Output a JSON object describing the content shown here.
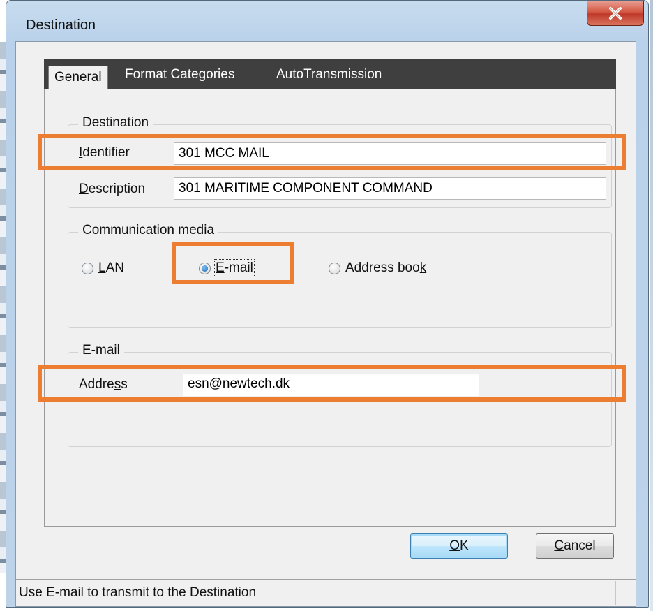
{
  "window": {
    "title": "Destination",
    "close_icon": "close-icon"
  },
  "tabs": [
    {
      "label": "General",
      "active": true
    },
    {
      "label": "Format Categories",
      "active": false
    },
    {
      "label": "AutoTransmission",
      "active": false
    }
  ],
  "destination_group": {
    "legend": "Destination",
    "identifier_label_ul": "I",
    "identifier_label_rest": "dentifier",
    "identifier_value": "301 MCC MAIL",
    "description_label_ul": "D",
    "description_label_rest": "escription",
    "description_value": "301 MARITIME COMPONENT COMMAND"
  },
  "media_group": {
    "legend": "Communication media",
    "options": [
      {
        "ul": "L",
        "rest": "AN",
        "pre": "",
        "selected": false
      },
      {
        "pre": "",
        "ul": "E",
        "rest": "-mail",
        "selected": true
      },
      {
        "pre": "Address boo",
        "ul": "k",
        "rest": "",
        "selected": false
      }
    ]
  },
  "email_group": {
    "legend": "E-mail",
    "address_label_pre": "Addre",
    "address_label_ul": "s",
    "address_label_rest": "s",
    "address_value": "esn@newtech.dk"
  },
  "buttons": {
    "ok_ul": "O",
    "ok_rest": "K",
    "cancel_ul": "C",
    "cancel_rest": "ancel"
  },
  "status": {
    "text": "Use E-mail to transmit to the Destination"
  },
  "colors": {
    "highlight": "#ed7d31",
    "tabbar": "#3f3f3f",
    "close": "#c0392b"
  }
}
